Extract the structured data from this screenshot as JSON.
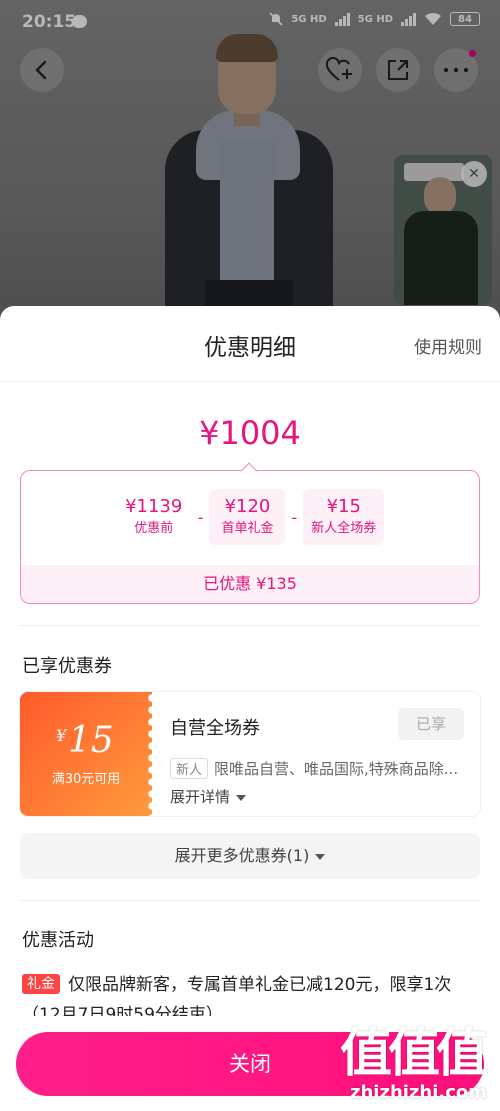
{
  "status_bar": {
    "time": "20:15",
    "network1": "5G HD",
    "network2": "5G HD",
    "battery": "84"
  },
  "icons": {
    "back": "back-icon",
    "favorite": "heart-plus-icon",
    "share": "share-icon",
    "more": "more-icon",
    "close_video": "close-icon"
  },
  "sheet": {
    "title": "优惠明细",
    "rules_link": "使用规则",
    "final_price": "¥1004"
  },
  "breakdown": {
    "items": [
      {
        "amount": "¥1139",
        "label": "优惠前"
      },
      {
        "amount": "¥120",
        "label": "首单礼金"
      },
      {
        "amount": "¥15",
        "label": "新人全场券"
      }
    ],
    "operators": [
      "-",
      "-"
    ],
    "saved": "已优惠 ¥135"
  },
  "coupons_section": {
    "title": "已享优惠券",
    "coupon": {
      "currency": "¥",
      "value": "15",
      "condition": "满30元可用",
      "name": "自营全场券",
      "status": "已享",
      "tag": "新人",
      "description": "限唯品自营、唯品国际,特殊商品除...",
      "expand": "展开详情"
    },
    "more_button": "展开更多优惠券(1)"
  },
  "activity_section": {
    "title": "优惠活动",
    "tag": "礼金",
    "text": "仅限品牌新客，专属首单礼金已减120元，限享1次（12月7日9时59分结束）"
  },
  "close_button": "关闭",
  "watermark": {
    "chars": "值值值",
    "url": "zhizhizhi.com"
  },
  "colors": {
    "accent": "#e6157f",
    "button": "#ff1f8a",
    "coupon_gradient_start": "#ff5a2c",
    "coupon_gradient_end": "#ff9a3c",
    "gift_tag": "#ff4444"
  }
}
